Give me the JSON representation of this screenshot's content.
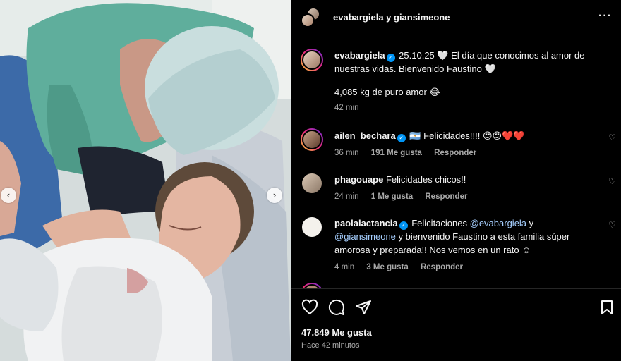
{
  "header": {
    "username": "evabargiela y giansimeone",
    "more_icon": "more-horizontal-icon"
  },
  "caption": {
    "username": "evabargiela",
    "text1": "25.10.25 🤍 El día que conocimos al amor de nuestras vidas. Bienvenido Faustino 🤍",
    "text2": "4,085 kg de puro amor 😂",
    "time": "42 min"
  },
  "comments": [
    {
      "username": "ailen_bechara",
      "text": "🇦🇷 Felicidades!!!! 😍😍❤️❤️",
      "time": "36 min",
      "likes": "191 Me gusta",
      "reply": "Responder"
    },
    {
      "username": "phagouape",
      "text": "Felicidades chicos!!",
      "time": "24 min",
      "likes": "1 Me gusta",
      "reply": "Responder"
    },
    {
      "username": "paolalactancia",
      "text_a": "Felicitaciones",
      "mention1": "@evabargiela",
      "text_b": "y",
      "mention2": "@giansimeone",
      "text_c": "y bienvenido Faustino a esta familia súper amorosa y preparada!! Nos vemos en un rato ☺",
      "time": "4 min",
      "likes": "3 Me gusta",
      "reply": "Responder"
    }
  ],
  "actions": {
    "like_icon": "heart-icon",
    "comment_icon": "comment-icon",
    "share_icon": "send-icon",
    "save_icon": "bookmark-icon"
  },
  "footer": {
    "likes": "47.849 Me gusta",
    "ago": "Hace 42 minutos"
  },
  "carousel": {
    "prev_icon": "chevron-left-icon",
    "next_icon": "chevron-right-icon"
  },
  "colors": {
    "background": "#000000",
    "verified": "#0095f6",
    "secondary_text": "#a8a8a8"
  }
}
